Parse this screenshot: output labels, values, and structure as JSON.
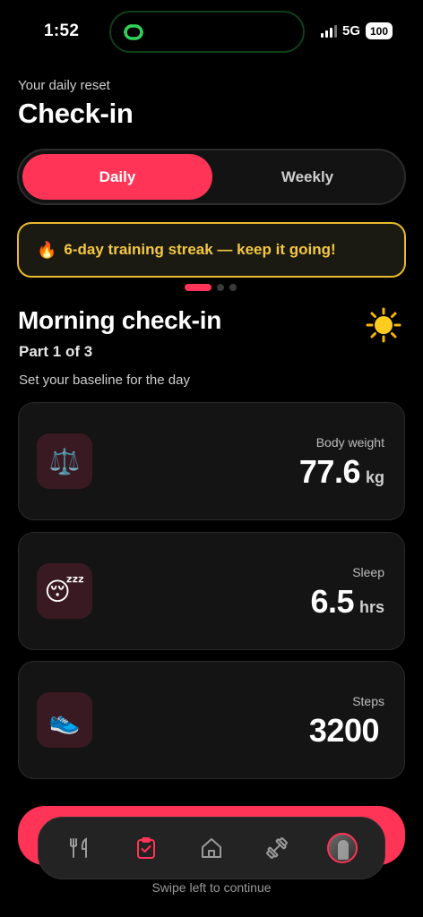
{
  "status_bar": {
    "time": "1:52",
    "network": "5G",
    "battery": "100",
    "island_icon": "link-rings-icon"
  },
  "header": {
    "subtitle": "Your daily reset",
    "title": "Check-in"
  },
  "segmented": {
    "options": [
      "Daily",
      "Weekly"
    ],
    "selected": "Daily"
  },
  "banner": {
    "icon": "🔥",
    "text": "6-day training streak — keep it going!"
  },
  "pager": {
    "count": 3,
    "active": 0
  },
  "section": {
    "title": "Morning check-in",
    "part": "Part 1 of 3",
    "description": "Set your baseline for the day",
    "icon": "sun-icon"
  },
  "metrics": [
    {
      "label": "Body weight",
      "value": "77.6",
      "unit": "kg",
      "icon": "⚖️",
      "icon_name": "scale-icon"
    },
    {
      "label": "Sleep",
      "value": "6.5",
      "unit": "hrs",
      "icon": "😴",
      "icon_name": "sleeping-face-icon"
    },
    {
      "label": "Steps",
      "value": "3200",
      "unit": "",
      "icon": "👟",
      "icon_name": "shoe-icon"
    }
  ],
  "tabbar": {
    "items": [
      "fork-knife-icon",
      "clipboard-check-icon",
      "home-icon",
      "dumbbell-icon",
      "avatar"
    ],
    "active": "clipboard-check-icon"
  },
  "footer": {
    "hint": "Swipe left to continue"
  },
  "colors": {
    "accent": "#ff3457",
    "streak": "#f5c842",
    "background": "#000000"
  }
}
